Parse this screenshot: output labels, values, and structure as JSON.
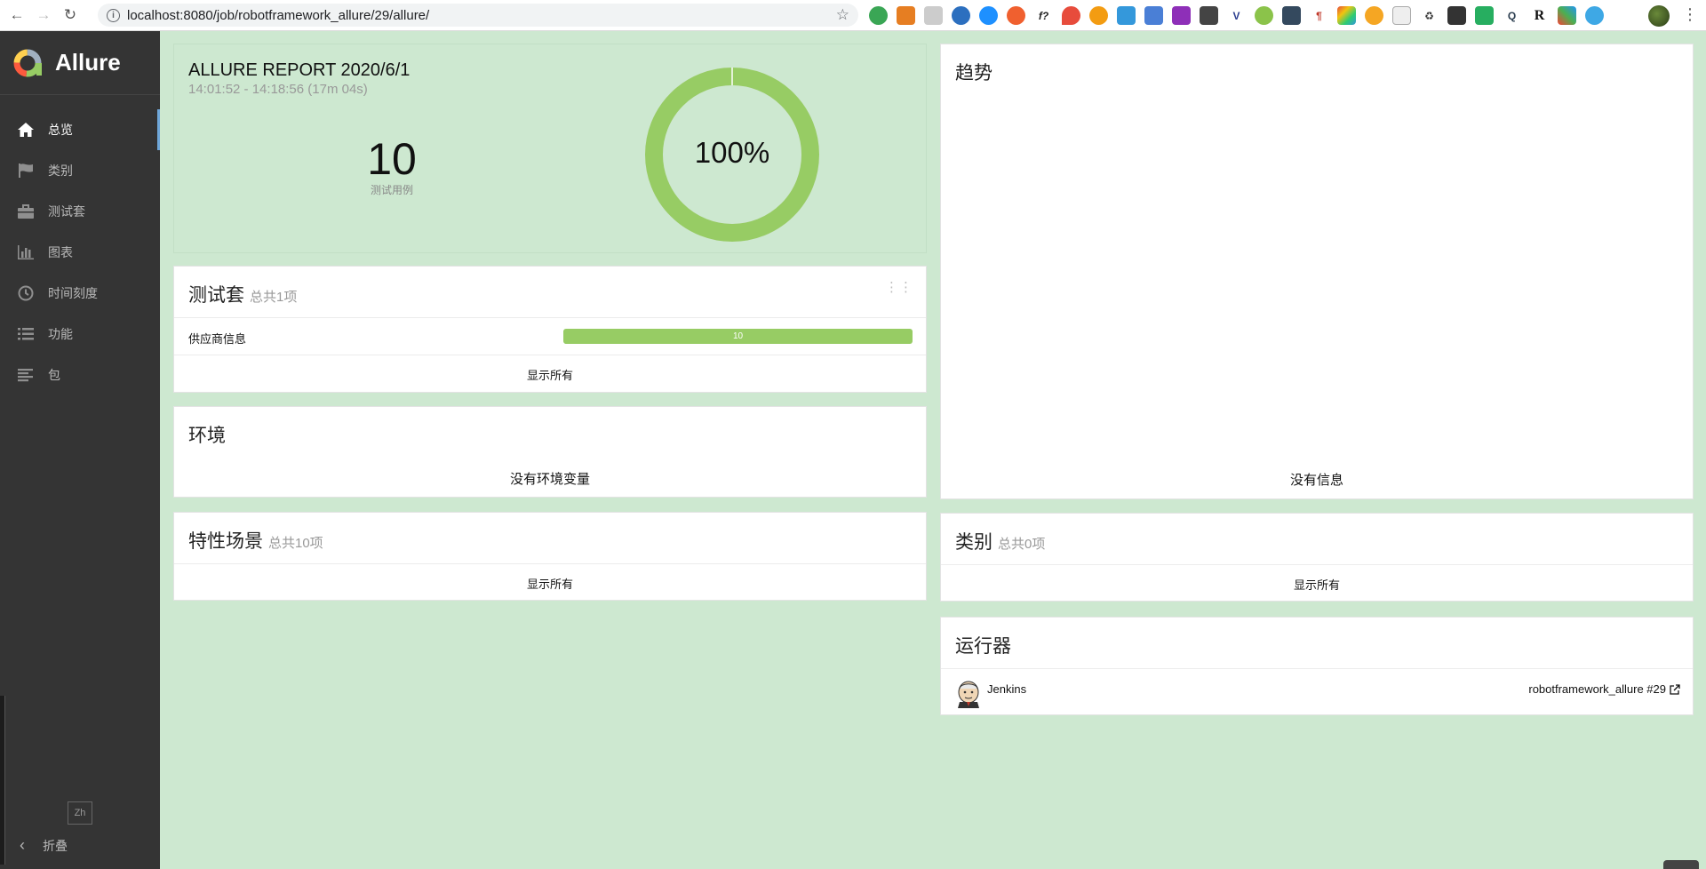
{
  "browser": {
    "url": "localhost:8080/job/robotframework_allure/29/allure/"
  },
  "sidebar": {
    "brand": "Allure",
    "items": [
      {
        "label": "总览",
        "icon": "home-icon"
      },
      {
        "label": "类别",
        "icon": "flag-icon"
      },
      {
        "label": "测试套",
        "icon": "briefcase-icon"
      },
      {
        "label": "图表",
        "icon": "bar-chart-icon"
      },
      {
        "label": "时间刻度",
        "icon": "clock-icon"
      },
      {
        "label": "功能",
        "icon": "list-icon"
      },
      {
        "label": "包",
        "icon": "align-left-icon"
      }
    ],
    "lang": "Zh",
    "collapse_label": "折叠"
  },
  "summary": {
    "title": "ALLURE REPORT 2020/6/1",
    "time_range": "14:01:52 - 14:18:56 (17m 04s)",
    "test_count": "10",
    "test_count_label": "测试用例",
    "pass_rate": "100%",
    "pass_fraction": 1.0,
    "pass_color": "#97cc64"
  },
  "suites": {
    "title": "测试套",
    "subtitle": "总共1项",
    "rows": [
      {
        "name": "供应商信息",
        "count": "10"
      }
    ],
    "show_all": "显示所有"
  },
  "environment": {
    "title": "环境",
    "empty": "没有环境变量"
  },
  "features": {
    "title": "特性场景",
    "subtitle": "总共10项",
    "show_all": "显示所有"
  },
  "trend": {
    "title": "趋势",
    "empty": "没有信息"
  },
  "categories": {
    "title": "类别",
    "subtitle": "总共0项",
    "show_all": "显示所有"
  },
  "executors": {
    "title": "运行器",
    "name": "Jenkins",
    "link": "robotframework_allure #29"
  }
}
